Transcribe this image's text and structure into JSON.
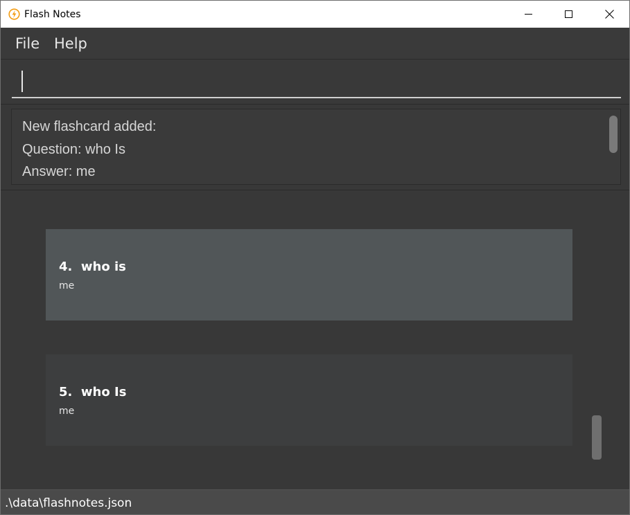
{
  "window": {
    "title": "Flash Notes",
    "icon": "flash-icon",
    "controls": [
      "minimize-icon",
      "maximize-icon",
      "close-icon"
    ]
  },
  "menu": {
    "items": [
      {
        "label": "File"
      },
      {
        "label": "Help"
      }
    ]
  },
  "command": {
    "value": "",
    "placeholder": ""
  },
  "result": {
    "lines": [
      "New flashcard added:",
      "Question: who Is",
      "Answer: me"
    ]
  },
  "flashcards": [
    {
      "index": "4.",
      "question": "who is",
      "answer": "me",
      "selected": true
    },
    {
      "index": "5.",
      "question": "who Is",
      "answer": "me",
      "selected": false
    }
  ],
  "status": {
    "path": ".\\data\\flashnotes.json"
  },
  "colors": {
    "accent": "#f39c12",
    "selected_card": "#515658",
    "card": "#3d3e3f",
    "background": "#383838"
  }
}
